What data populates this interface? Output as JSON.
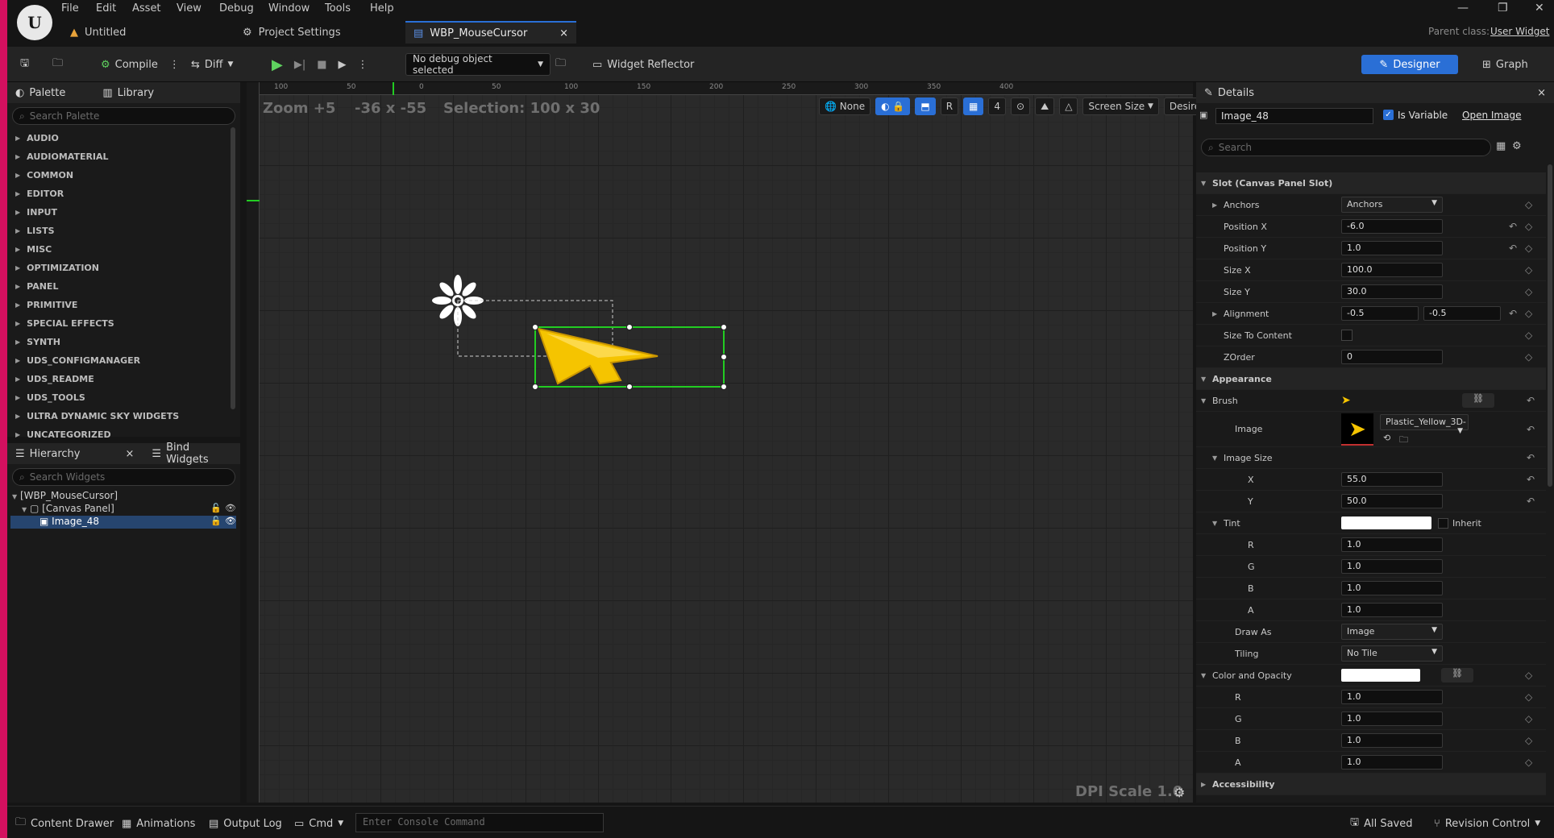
{
  "menu": [
    "File",
    "Edit",
    "Asset",
    "View",
    "Debug",
    "Window",
    "Tools",
    "Help"
  ],
  "tabs": [
    {
      "label": "Untitled"
    },
    {
      "label": "Project Settings"
    },
    {
      "label": "WBP_MouseCursor"
    }
  ],
  "parent_class": {
    "label": "Parent class:",
    "value": "User Widget"
  },
  "toolbar": {
    "compile": "Compile",
    "diff": "Diff",
    "debug_object": "No debug object selected",
    "widget_reflector": "Widget Reflector",
    "designer": "Designer",
    "graph": "Graph"
  },
  "palette": {
    "tab": "Palette",
    "library_tab": "Library",
    "search_placeholder": "Search Palette",
    "categories": [
      "AUDIO",
      "AUDIOMATERIAL",
      "COMMON",
      "EDITOR",
      "INPUT",
      "LISTS",
      "MISC",
      "OPTIMIZATION",
      "PANEL",
      "PRIMITIVE",
      "SPECIAL EFFECTS",
      "SYNTH",
      "UDS_CONFIGMANAGER",
      "UDS_README",
      "UDS_TOOLS",
      "ULTRA DYNAMIC SKY WIDGETS",
      "UNCATEGORIZED"
    ]
  },
  "hierarchy": {
    "tab": "Hierarchy",
    "bind_tab": "Bind Widgets",
    "search_placeholder": "Search Widgets",
    "items": [
      "[WBP_MouseCursor]",
      "[Canvas Panel]",
      "Image_48"
    ]
  },
  "viewport": {
    "zoom": "Zoom +5",
    "coords": "-36 x -55",
    "selection": "Selection: 100 x 30",
    "none": "None",
    "r": "R",
    "grid": "4",
    "screen_size": "Screen Size",
    "desired": "Desired",
    "dpi": "DPI Scale 1.0",
    "ruler_top": [
      "100",
      "50",
      "0",
      "50",
      "100",
      "150",
      "200",
      "250",
      "300",
      "350",
      "400"
    ]
  },
  "details": {
    "tab": "Details",
    "name": "Image_48",
    "is_variable": "Is Variable",
    "open_image": "Open Image",
    "search_placeholder": "Search",
    "slot": "Slot (Canvas Panel Slot)",
    "anchors_label": "Anchors",
    "anchors_value": "Anchors",
    "position_x": {
      "label": "Position X",
      "value": "-6.0"
    },
    "position_y": {
      "label": "Position Y",
      "value": "1.0"
    },
    "size_x": {
      "label": "Size X",
      "value": "100.0"
    },
    "size_y": {
      "label": "Size Y",
      "value": "30.0"
    },
    "alignment": {
      "label": "Alignment",
      "x": "-0.5",
      "y": "-0.5"
    },
    "size_to_content": "Size To Content",
    "zorder": {
      "label": "ZOrder",
      "value": "0"
    },
    "appearance": "Appearance",
    "brush": "Brush",
    "image_label": "Image",
    "image_asset": "Plastic_Yellow_3D-",
    "image_size": "Image Size",
    "img_x": {
      "label": "X",
      "value": "55.0"
    },
    "img_y": {
      "label": "Y",
      "value": "50.0"
    },
    "tint": "Tint",
    "inherit": "Inherit",
    "tint_r": {
      "label": "R",
      "value": "1.0"
    },
    "tint_g": {
      "label": "G",
      "value": "1.0"
    },
    "tint_b": {
      "label": "B",
      "value": "1.0"
    },
    "tint_a": {
      "label": "A",
      "value": "1.0"
    },
    "draw_as": {
      "label": "Draw As",
      "value": "Image"
    },
    "tiling": {
      "label": "Tiling",
      "value": "No Tile"
    },
    "color_opacity": "Color and Opacity",
    "co_r": {
      "label": "R",
      "value": "1.0"
    },
    "co_g": {
      "label": "G",
      "value": "1.0"
    },
    "co_b": {
      "label": "B",
      "value": "1.0"
    },
    "co_a": {
      "label": "A",
      "value": "1.0"
    },
    "accessibility": "Accessibility"
  },
  "status": {
    "content_drawer": "Content Drawer",
    "animations": "Animations",
    "output_log": "Output Log",
    "cmd": "Cmd",
    "console_placeholder": "Enter Console Command",
    "all_saved": "All Saved",
    "revision_control": "Revision Control"
  },
  "colors": {
    "accent": "#2a6fd6",
    "selection": "#22cc22",
    "cursor": "#f5c400"
  }
}
